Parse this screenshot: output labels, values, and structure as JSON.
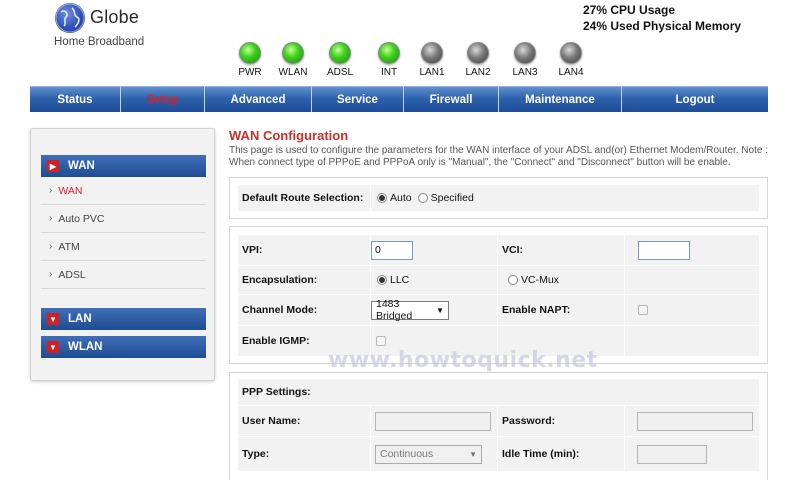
{
  "brand": {
    "name": "Globe",
    "subtitle": "Home Broadband"
  },
  "system": {
    "cpu": "27% CPU Usage",
    "memory": "24% Used Physical Memory"
  },
  "leds": [
    {
      "label": "PWR",
      "state": "on"
    },
    {
      "label": "WLAN",
      "state": "on"
    },
    {
      "label": "ADSL",
      "state": "on"
    },
    {
      "label": "INT",
      "state": "on"
    },
    {
      "label": "LAN1",
      "state": "off"
    },
    {
      "label": "LAN2",
      "state": "off"
    },
    {
      "label": "LAN3",
      "state": "off"
    },
    {
      "label": "LAN4",
      "state": "off"
    }
  ],
  "nav": [
    {
      "label": "Status"
    },
    {
      "label": "Setup",
      "active": true
    },
    {
      "label": "Advanced"
    },
    {
      "label": "Service"
    },
    {
      "label": "Firewall"
    },
    {
      "label": "Maintenance"
    },
    {
      "label": "Logout"
    }
  ],
  "sidebar": {
    "wan_header": "WAN",
    "wan_items": [
      "WAN",
      "Auto PVC",
      "ATM",
      "ADSL"
    ],
    "lan_header": "LAN",
    "wlan_header": "WLAN"
  },
  "page": {
    "title": "WAN Configuration",
    "description": "This page is used to configure the parameters for the WAN interface of your ADSL and(or) Ethernet Modem/Router. Note : When connect type of PPPoE and PPPoA only is \"Manual\", the \"Connect\" and \"Disconnect\" button will be enable."
  },
  "default_route": {
    "label": "Default Route Selection:",
    "option_auto": "Auto",
    "option_specified": "Specified",
    "selected": "Auto"
  },
  "atm": {
    "vpi_label": "VPI:",
    "vpi_value": "0",
    "vci_label": "VCI:",
    "vci_value": "",
    "encap_label": "Encapsulation:",
    "encap_llc": "LLC",
    "encap_vcmux": "VC-Mux",
    "encap_selected": "LLC",
    "channel_label": "Channel Mode:",
    "channel_value": "1483 Bridged",
    "napt_label": "Enable NAPT:",
    "napt_checked": false,
    "igmp_label": "Enable IGMP:",
    "igmp_checked": false
  },
  "ppp": {
    "section_label": "PPP Settings:",
    "username_label": "User Name:",
    "username_value": "",
    "password_label": "Password:",
    "password_value": "",
    "type_label": "Type:",
    "type_value": "Continuous",
    "idle_label": "Idle Time (min):",
    "idle_value": ""
  },
  "watermark": "www.howtoquick.net",
  "colors": {
    "nav_blue": "#2f62ad",
    "title_red": "#c8302a",
    "active_red": "#e02020",
    "led_on": "#3fd21f",
    "led_off": "#7a7a7a"
  }
}
